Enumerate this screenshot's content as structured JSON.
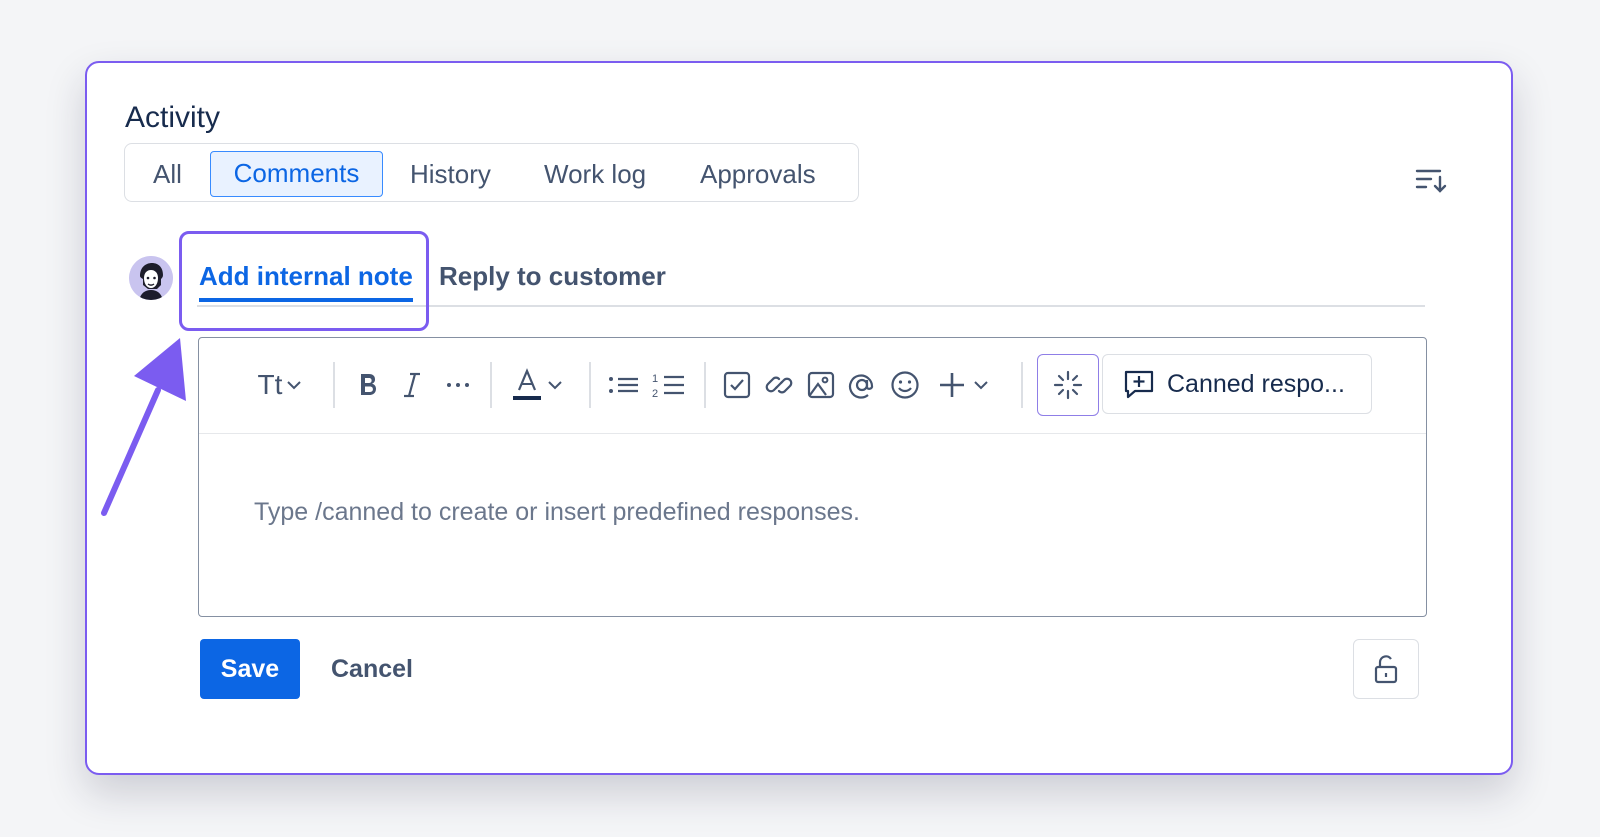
{
  "activity": {
    "title": "Activity",
    "tabs": [
      {
        "label": "All",
        "active": false
      },
      {
        "label": "Comments",
        "active": true
      },
      {
        "label": "History",
        "active": false
      },
      {
        "label": "Work log",
        "active": false
      },
      {
        "label": "Approvals",
        "active": false
      }
    ]
  },
  "comment": {
    "tabs": [
      {
        "label": "Add internal note",
        "active": true
      },
      {
        "label": "Reply to customer",
        "active": false
      }
    ],
    "toolbar": {
      "text_style_label": "Tt",
      "icons": [
        "text-style-icon",
        "bold-icon",
        "italic-icon",
        "more-formatting-icon",
        "text-color-icon",
        "bullet-list-icon",
        "numbered-list-icon",
        "checkbox-icon",
        "link-icon",
        "image-icon",
        "mention-icon",
        "emoji-icon",
        "insert-plus-icon",
        "ai-sparkle-icon",
        "canned-response-icon"
      ],
      "canned_label": "Canned respo..."
    },
    "placeholder": "Type /canned to create or insert predefined responses.",
    "save_label": "Save",
    "cancel_label": "Cancel"
  },
  "colors": {
    "accent": "#0c66e4",
    "highlight": "#7b5cf0",
    "text": "#172b4d",
    "muted": "#44546f"
  }
}
